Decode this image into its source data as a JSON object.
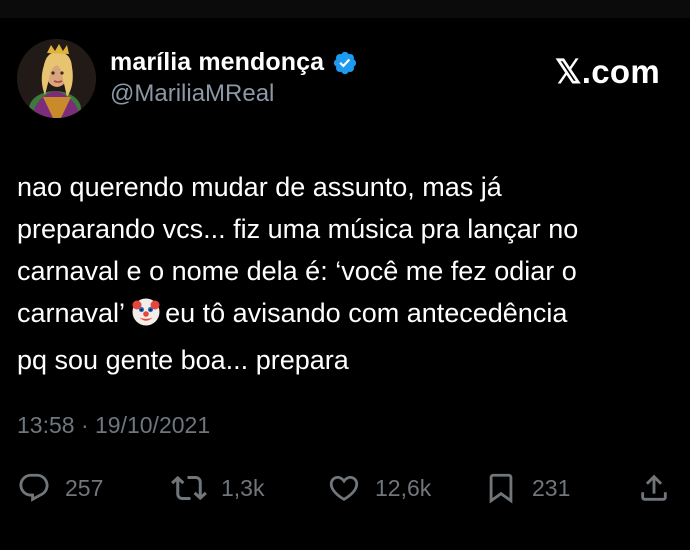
{
  "header": {
    "display_name": "marília mendonça",
    "handle": "@MariliaMReal",
    "verified_icon": "verified-badge-icon",
    "avatar_icon": "profile-photo",
    "brand": "𝕏.com"
  },
  "tweet": {
    "lines": [
      "nao querendo mudar de assunto, mas já",
      "preparando vcs... fiz uma música pra lançar no",
      "carnaval e o nome dela é: ‘você me fez odiar o",
      "carnaval’",
      "eu tô avisando com antecedência",
      "pq sou gente boa... prepara"
    ],
    "emoji_icon": "clown-face-emoji",
    "timestamp": "13:58 · 19/10/2021"
  },
  "actions": {
    "reply": {
      "icon": "reply-icon",
      "count": "257"
    },
    "retweet": {
      "icon": "retweet-icon",
      "count": "1,3k"
    },
    "like": {
      "icon": "heart-icon",
      "count": "12,6k"
    },
    "bookmark": {
      "icon": "bookmark-icon",
      "count": "231"
    },
    "share": {
      "icon": "share-icon"
    }
  },
  "colors": {
    "background": "#000000",
    "text_primary": "#ffffff",
    "text_secondary": "#8b98a5",
    "verified": "#1d9bf0"
  }
}
